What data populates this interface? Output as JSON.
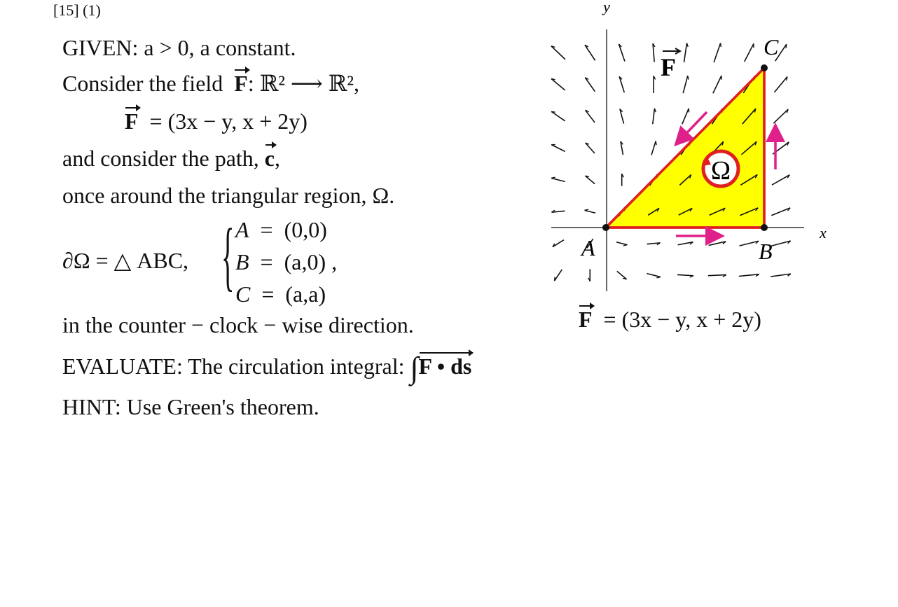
{
  "header": "[15] (1)",
  "lines": {
    "given": "GIVEN:  a > 0, a constant.",
    "consider_field": "Consider the field",
    "field_map": ": ℝ² ⟶ ℝ²,",
    "field_def": "= (3x − y,  x + 2y)",
    "path": "and consider the path,",
    "path_name": "c",
    "region": "once around the triangular region, Ω.",
    "boundary_lhs": "∂Ω  =  △ ABC,",
    "points": [
      {
        "label": "A",
        "value": "(0,0)"
      },
      {
        "label": "B",
        "value": "(a,0)"
      },
      {
        "label": "C",
        "value": "(a,a)"
      }
    ],
    "direction": "in the counter − clock − wise direction.",
    "evaluate": "EVALUATE:   The circulation integral:",
    "integral": "F • ds",
    "hint": "HINT:  Use Green's theorem."
  },
  "figure": {
    "axis_x": "x",
    "axis_y": "y",
    "vertices": {
      "A": "A",
      "B": "B",
      "C": "C"
    },
    "region_label": "Ω",
    "field_label": "F",
    "caption": "= (3x − y,  x + 2y)",
    "colors": {
      "region": "#ffff00",
      "boundary": "#e02020",
      "direction_arrows": "#e0208a",
      "field": "#111111"
    }
  }
}
